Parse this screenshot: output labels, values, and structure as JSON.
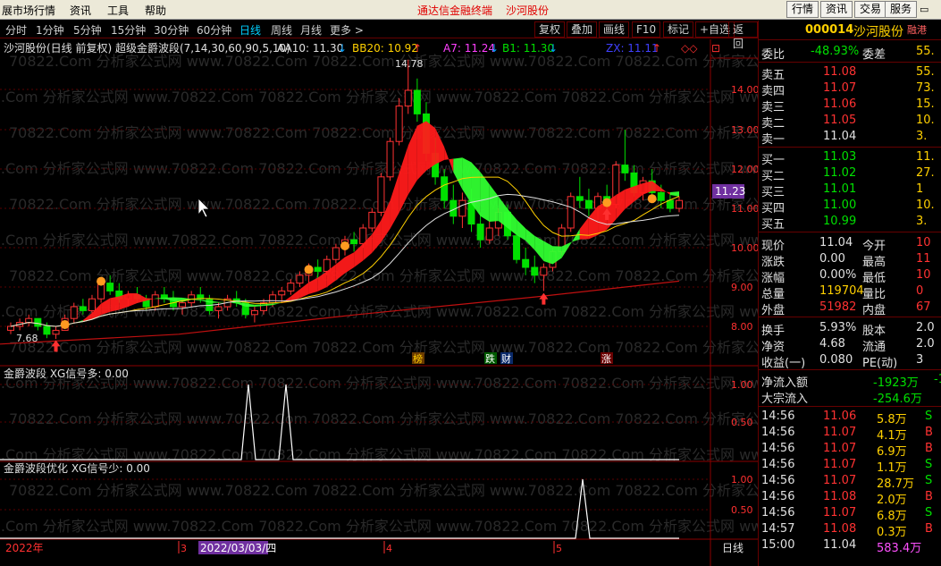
{
  "menu": {
    "items": [
      "展市场行情",
      "资讯",
      "工具",
      "帮助"
    ],
    "center_title": "通达信金融终端",
    "stock_title": "沙河股份",
    "right_buttons": [
      "行情",
      "资讯",
      "交易",
      "服务"
    ]
  },
  "period_bar": {
    "periods": [
      "分时",
      "1分钟",
      "5分钟",
      "15分钟",
      "30分钟",
      "60分钟",
      "日线",
      "周线",
      "月线",
      "更多 >"
    ],
    "active": "日线",
    "tools": [
      "复权",
      "叠加",
      "画线",
      "F10",
      "标记",
      "+自选",
      "返回"
    ]
  },
  "chart_header": {
    "title": "沙河股份(日线 前复权) 超级金爵波段(7,14,30,60,90,5,10)",
    "aa10": "AA10: 11.30",
    "bb20": "BB20: 10.92",
    "a7": "A7: 11.24",
    "b1": "B1: 11.30",
    "zx": "ZX: 11.11"
  },
  "chart_data": {
    "type": "candlestick",
    "price_axis": [
      "14.00",
      "13.00",
      "12.00",
      "11.00",
      "10.00",
      "9.00",
      "8.00"
    ],
    "current_price": "11.23",
    "high_label": "14.78",
    "low_label": "7.68",
    "event_markers": [
      "榜",
      "跌",
      "财",
      "涨"
    ],
    "candles": [
      [
        7.9,
        8.1,
        7.8,
        8.0
      ],
      [
        8.0,
        8.2,
        7.9,
        8.1
      ],
      [
        8.1,
        8.3,
        8.0,
        8.2
      ],
      [
        8.2,
        8.2,
        7.9,
        8.0
      ],
      [
        8.0,
        8.1,
        7.7,
        7.8
      ],
      [
        7.8,
        8.0,
        7.68,
        7.9
      ],
      [
        7.9,
        8.3,
        7.9,
        8.2
      ],
      [
        8.2,
        8.6,
        8.1,
        8.5
      ],
      [
        8.5,
        8.7,
        8.3,
        8.4
      ],
      [
        8.4,
        8.8,
        8.3,
        8.7
      ],
      [
        8.7,
        9.2,
        8.6,
        9.1
      ],
      [
        9.1,
        9.3,
        8.8,
        8.9
      ],
      [
        8.9,
        9.1,
        8.6,
        8.7
      ],
      [
        8.7,
        8.9,
        8.5,
        8.8
      ],
      [
        8.8,
        9.0,
        8.6,
        8.7
      ],
      [
        8.7,
        8.8,
        8.4,
        8.5
      ],
      [
        8.5,
        8.9,
        8.4,
        8.8
      ],
      [
        8.8,
        9.0,
        8.6,
        8.7
      ],
      [
        8.7,
        8.9,
        8.4,
        8.5
      ],
      [
        8.5,
        8.7,
        8.3,
        8.6
      ],
      [
        8.6,
        8.9,
        8.5,
        8.8
      ],
      [
        8.8,
        9.0,
        8.6,
        8.7
      ],
      [
        8.7,
        8.8,
        8.3,
        8.4
      ],
      [
        8.4,
        8.6,
        8.2,
        8.5
      ],
      [
        8.5,
        8.8,
        8.4,
        8.7
      ],
      [
        8.7,
        8.9,
        8.5,
        8.6
      ],
      [
        8.6,
        8.7,
        8.2,
        8.3
      ],
      [
        8.3,
        8.5,
        8.1,
        8.4
      ],
      [
        8.4,
        8.7,
        8.3,
        8.6
      ],
      [
        8.6,
        8.9,
        8.5,
        8.8
      ],
      [
        8.8,
        9.0,
        8.6,
        8.9
      ],
      [
        8.9,
        9.2,
        8.8,
        9.1
      ],
      [
        9.1,
        9.4,
        9.0,
        9.3
      ],
      [
        9.3,
        9.6,
        9.1,
        9.5
      ],
      [
        9.5,
        9.7,
        9.2,
        9.4
      ],
      [
        9.4,
        9.8,
        9.3,
        9.7
      ],
      [
        9.7,
        10.1,
        9.6,
        10.0
      ],
      [
        10.0,
        10.3,
        9.8,
        10.2
      ],
      [
        10.2,
        10.4,
        9.9,
        10.1
      ],
      [
        10.1,
        10.6,
        10.0,
        10.5
      ],
      [
        10.5,
        11.0,
        10.4,
        10.9
      ],
      [
        10.9,
        11.9,
        10.8,
        11.8
      ],
      [
        11.8,
        12.8,
        11.7,
        12.7
      ],
      [
        12.7,
        13.8,
        12.6,
        13.6
      ],
      [
        13.6,
        14.78,
        13.4,
        14.0
      ],
      [
        14.0,
        14.3,
        13.2,
        13.4
      ],
      [
        13.4,
        13.7,
        12.2,
        12.4
      ],
      [
        12.4,
        12.8,
        11.6,
        11.8
      ],
      [
        11.8,
        12.0,
        11.0,
        11.2
      ],
      [
        11.2,
        11.6,
        10.6,
        10.8
      ],
      [
        10.8,
        11.4,
        10.5,
        11.2
      ],
      [
        11.2,
        11.5,
        10.4,
        10.6
      ],
      [
        10.6,
        10.9,
        10.0,
        10.2
      ],
      [
        10.2,
        10.7,
        10.1,
        10.5
      ],
      [
        10.5,
        11.0,
        10.3,
        10.9
      ],
      [
        10.9,
        11.1,
        10.2,
        10.3
      ],
      [
        10.3,
        10.4,
        9.6,
        9.7
      ],
      [
        9.7,
        10.0,
        9.3,
        9.5
      ],
      [
        9.5,
        9.8,
        9.1,
        9.3
      ],
      [
        9.3,
        9.6,
        8.9,
        9.5
      ],
      [
        9.5,
        10.0,
        9.4,
        9.9
      ],
      [
        9.9,
        10.6,
        9.8,
        10.5
      ],
      [
        10.5,
        11.4,
        10.4,
        11.3
      ],
      [
        11.3,
        11.8,
        11.0,
        11.2
      ],
      [
        11.2,
        11.5,
        10.8,
        11.0
      ],
      [
        11.0,
        11.4,
        10.7,
        11.3
      ],
      [
        11.3,
        11.6,
        10.9,
        11.1
      ],
      [
        11.1,
        12.2,
        11.0,
        12.1
      ],
      [
        12.1,
        13.0,
        11.7,
        11.9
      ],
      [
        11.9,
        12.1,
        11.3,
        11.4
      ],
      [
        11.4,
        11.8,
        11.2,
        11.7
      ],
      [
        11.7,
        12.0,
        11.3,
        11.4
      ],
      [
        11.4,
        11.6,
        11.0,
        11.2
      ],
      [
        11.2,
        11.4,
        10.9,
        11.0
      ],
      [
        11.0,
        11.3,
        10.9,
        11.2
      ]
    ]
  },
  "indicator1": {
    "title": "金爵波段 XG信号多: 0.00",
    "axis_top": "1.00",
    "axis_mid": "0.50"
  },
  "indicator2": {
    "title": "金爵波段优化 XG信号少: 0.00",
    "axis_top": "1.00",
    "axis_mid": "0.50"
  },
  "date_bar": {
    "year": "2022年",
    "m3": "3",
    "cursor_date": "2022/03/03/四",
    "m4": "4",
    "m5": "5",
    "period": "日线"
  },
  "watermark": "70822.Com 分析家公式网 www.70822.Com",
  "side": {
    "code": "000014",
    "name": "沙河股份",
    "hk": "融港",
    "weibi_label": "委比",
    "weibi": "-48.93%",
    "weicha_label": "委差",
    "weicha": "55.",
    "asks": [
      {
        "label": "卖五",
        "price": "11.08",
        "vol": "55."
      },
      {
        "label": "卖四",
        "price": "11.07",
        "vol": "73."
      },
      {
        "label": "卖三",
        "price": "11.06",
        "vol": "15."
      },
      {
        "label": "卖二",
        "price": "11.05",
        "vol": "10."
      },
      {
        "label": "卖一",
        "price": "11.04",
        "vol": "3."
      }
    ],
    "bids": [
      {
        "label": "买一",
        "price": "11.03",
        "vol": "11."
      },
      {
        "label": "买二",
        "price": "11.02",
        "vol": "27."
      },
      {
        "label": "买三",
        "price": "11.01",
        "vol": "1"
      },
      {
        "label": "买四",
        "price": "11.00",
        "vol": "10."
      },
      {
        "label": "买五",
        "price": "10.99",
        "vol": "3."
      }
    ],
    "stats": [
      {
        "l1": "现价",
        "v1": "11.04",
        "c1": "white",
        "l2": "今开",
        "v2": "10"
      },
      {
        "l1": "涨跌",
        "v1": "0.00",
        "c1": "white",
        "l2": "最高",
        "v2": "11"
      },
      {
        "l1": "涨幅",
        "v1": "0.00%",
        "c1": "white",
        "l2": "最低",
        "v2": "10"
      },
      {
        "l1": "总量",
        "v1": "119704",
        "c1": "yellow",
        "l2": "量比",
        "v2": "0"
      },
      {
        "l1": "外盘",
        "v1": "51982",
        "c1": "red",
        "l2": "内盘",
        "v2": "67"
      }
    ],
    "stats2": [
      {
        "l1": "换手",
        "v1": "5.93%",
        "l2": "股本",
        "v2": "2.0"
      },
      {
        "l1": "净资",
        "v1": "4.68",
        "l2": "流通",
        "v2": "2.0"
      },
      {
        "l1": "收益(一)",
        "v1": "0.080",
        "l2": "PE(动)",
        "v2": "3"
      }
    ],
    "flow": [
      {
        "label": "净流入额",
        "value": "-1923万",
        "extra": "-1"
      },
      {
        "label": "大宗流入",
        "value": "-254.6万",
        "extra": ""
      }
    ],
    "ticks": [
      {
        "time": "14:56",
        "price": "11.06",
        "vol": "5.8万",
        "side": "S"
      },
      {
        "time": "14:56",
        "price": "11.07",
        "vol": "4.1万",
        "side": "B"
      },
      {
        "time": "14:56",
        "price": "11.07",
        "vol": "6.9万",
        "side": "B"
      },
      {
        "time": "14:56",
        "price": "11.07",
        "vol": "1.1万",
        "side": "S"
      },
      {
        "time": "14:56",
        "price": "11.07",
        "vol": "28.7万",
        "side": "S"
      },
      {
        "time": "14:56",
        "price": "11.08",
        "vol": "2.0万",
        "side": "B"
      },
      {
        "time": "14:56",
        "price": "11.07",
        "vol": "6.8万",
        "side": "S"
      },
      {
        "time": "14:57",
        "price": "11.08",
        "vol": "0.3万",
        "side": "B"
      },
      {
        "time": "15:00",
        "price": "11.04",
        "vol": "583.4万",
        "side": ""
      }
    ]
  }
}
